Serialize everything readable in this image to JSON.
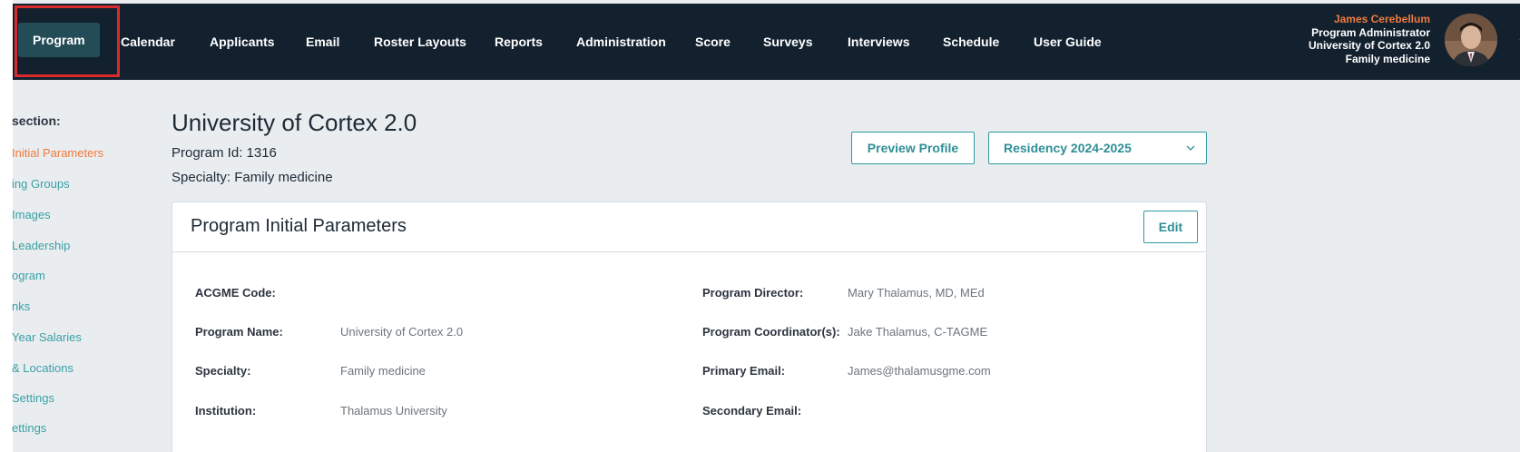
{
  "nav": {
    "items": [
      {
        "label": "Program"
      },
      {
        "label": "Calendar"
      },
      {
        "label": "Applicants"
      },
      {
        "label": "Email"
      },
      {
        "label": "Roster Layouts"
      },
      {
        "label": "Reports"
      },
      {
        "label": "Administration"
      },
      {
        "label": "Score"
      },
      {
        "label": "Surveys"
      },
      {
        "label": "Interviews"
      },
      {
        "label": "Schedule"
      },
      {
        "label": "User Guide"
      }
    ],
    "active_index": 0
  },
  "user": {
    "name": "James Cerebellum",
    "role": "Program Administrator",
    "institution": "University of Cortex 2.0",
    "specialty": "Family medicine"
  },
  "sidebar": {
    "heading": "section:",
    "items": [
      {
        "label": "Initial Parameters",
        "active": true
      },
      {
        "label": "ing Groups"
      },
      {
        "label": "Images"
      },
      {
        "label": "Leadership"
      },
      {
        "label": "ogram"
      },
      {
        "label": "nks"
      },
      {
        "label": "Year Salaries"
      },
      {
        "label": "& Locations"
      },
      {
        "label": "Settings"
      },
      {
        "label": "ettings"
      }
    ]
  },
  "header": {
    "title": "University of Cortex 2.0",
    "program_id": "Program Id: 1316",
    "specialty": "Specialty: Family medicine",
    "preview_button": "Preview Profile",
    "season_select": "Residency 2024-2025"
  },
  "card": {
    "title": "Program Initial Parameters",
    "edit_button": "Edit",
    "left_fields": [
      {
        "label": "ACGME Code:",
        "value": ""
      },
      {
        "label": "Program Name:",
        "value": "University of Cortex 2.0"
      },
      {
        "label": "Specialty:",
        "value": "Family medicine"
      },
      {
        "label": "Institution:",
        "value": "Thalamus University"
      }
    ],
    "right_fields": [
      {
        "label": "Program Director:",
        "value": "Mary Thalamus, MD, MEd"
      },
      {
        "label": "Program Coordinator(s):",
        "value": "Jake Thalamus, C-TAGME"
      },
      {
        "label": "Primary Email:",
        "value": "James@thalamusgme.com"
      },
      {
        "label": "Secondary Email:",
        "value": ""
      }
    ]
  },
  "colors": {
    "nav_bg": "#13212f",
    "nav_active_bg": "#234c57",
    "accent_teal": "#2f9aa0",
    "accent_orange": "#ef7b3e",
    "highlight_red": "#d92b2b",
    "page_bg": "#e9edf0"
  },
  "icons": {
    "user_menu": "chevron-down-icon",
    "select": "chevron-down-icon"
  }
}
